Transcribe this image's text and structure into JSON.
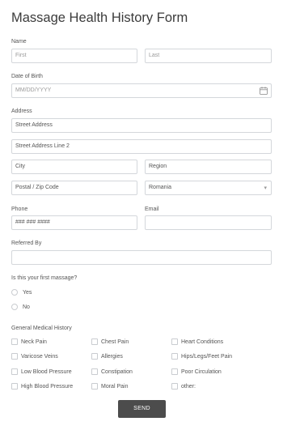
{
  "form": {
    "title": "Massage Health History Form",
    "name_label": "Name",
    "first_placeholder": "First",
    "last_placeholder": "Last",
    "dob_label": "Date of Birth",
    "dob_placeholder": "MM/DD/YYYY",
    "address_label": "Address",
    "street_placeholder": "Street Address",
    "street2_placeholder": "Street Address Line 2",
    "city_placeholder": "City",
    "region_placeholder": "Region",
    "postal_placeholder": "Postal / Zip Code",
    "country_value": "Romania",
    "phone_label": "Phone",
    "phone_placeholder": "### ### ####",
    "email_label": "Email",
    "referred_label": "Referred By",
    "first_massage_label": "Is this your first massage?",
    "yes_label": "Yes",
    "no_label": "No",
    "medical_label": "General Medical History",
    "send_label": "SEND"
  },
  "medical_history": {
    "col1": [
      "Neck Pain",
      "Varicose Veins",
      "Low Blood Pressure",
      "High Blood Pressure"
    ],
    "col2": [
      "Chest Pain",
      "Allergies",
      "Constipation",
      "Moral Pain"
    ],
    "col3": [
      "Heart Conditions",
      "Hips/Legs/Feet Pain",
      "Poor Circulation",
      "other:"
    ]
  },
  "icons": {
    "calendar": "calendar-icon",
    "dropdown": "chevron-down-icon"
  }
}
